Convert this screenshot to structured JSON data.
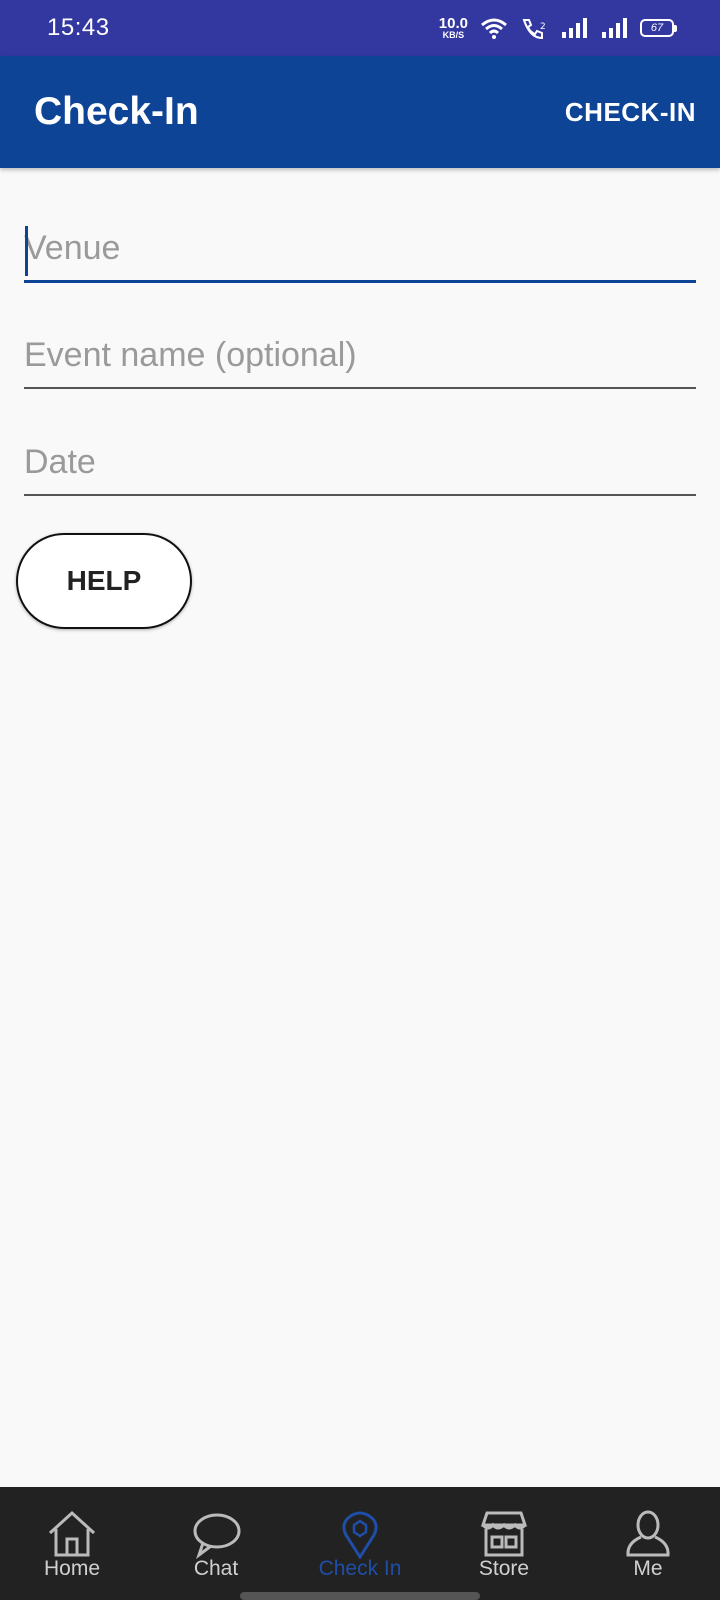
{
  "status_bar": {
    "time": "15:43",
    "net_speed_value": "10.0",
    "net_speed_unit": "KB/S",
    "battery": "67",
    "icons": [
      "wifi-icon",
      "volte-call-icon",
      "signal-icon",
      "signal-icon"
    ]
  },
  "app_bar": {
    "title": "Check-In",
    "action_label": "CHECK-IN"
  },
  "form": {
    "venue": {
      "value": "",
      "placeholder": "Venue"
    },
    "event_name": {
      "value": "",
      "placeholder": "Event name (optional)"
    },
    "date": {
      "value": "",
      "placeholder": "Date"
    },
    "help_label": "HELP"
  },
  "bottom_nav": {
    "items": [
      {
        "label": "Home",
        "icon": "home-icon"
      },
      {
        "label": "Chat",
        "icon": "chat-bubble-icon"
      },
      {
        "label": "Check In",
        "icon": "location-pin-icon",
        "active": true
      },
      {
        "label": "Store",
        "icon": "store-icon"
      },
      {
        "label": "Me",
        "icon": "person-icon"
      }
    ]
  },
  "colors": {
    "status_bar": "#3337a0",
    "app_bar": "#0d4496",
    "accent": "#1f4ea8",
    "nav_background": "#222222"
  }
}
